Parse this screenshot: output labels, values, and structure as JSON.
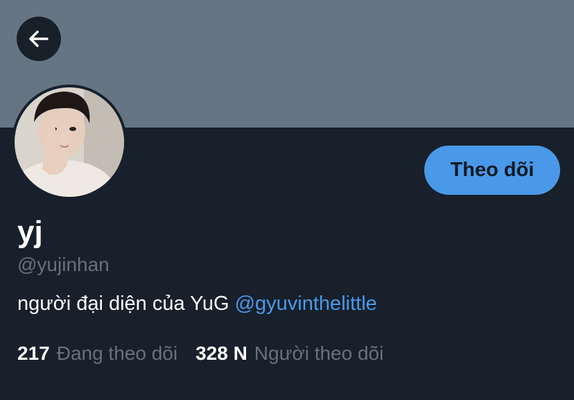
{
  "profile": {
    "display_name": "yj",
    "handle": "@yujinhan",
    "bio_text": "người đại diện của YuG ",
    "bio_mention": "@gyuvinthelittle",
    "avatar_icon": "profile-photo"
  },
  "actions": {
    "follow_label": "Theo dõi",
    "back_icon": "arrow-left-icon"
  },
  "stats": {
    "following_count": "217",
    "following_label": "Đang theo dõi",
    "followers_count": "328 N",
    "followers_label": "Người theo dõi"
  },
  "colors": {
    "banner": "#667584",
    "background": "#17202b",
    "accent": "#4a99e9",
    "muted_text": "#66727f"
  }
}
